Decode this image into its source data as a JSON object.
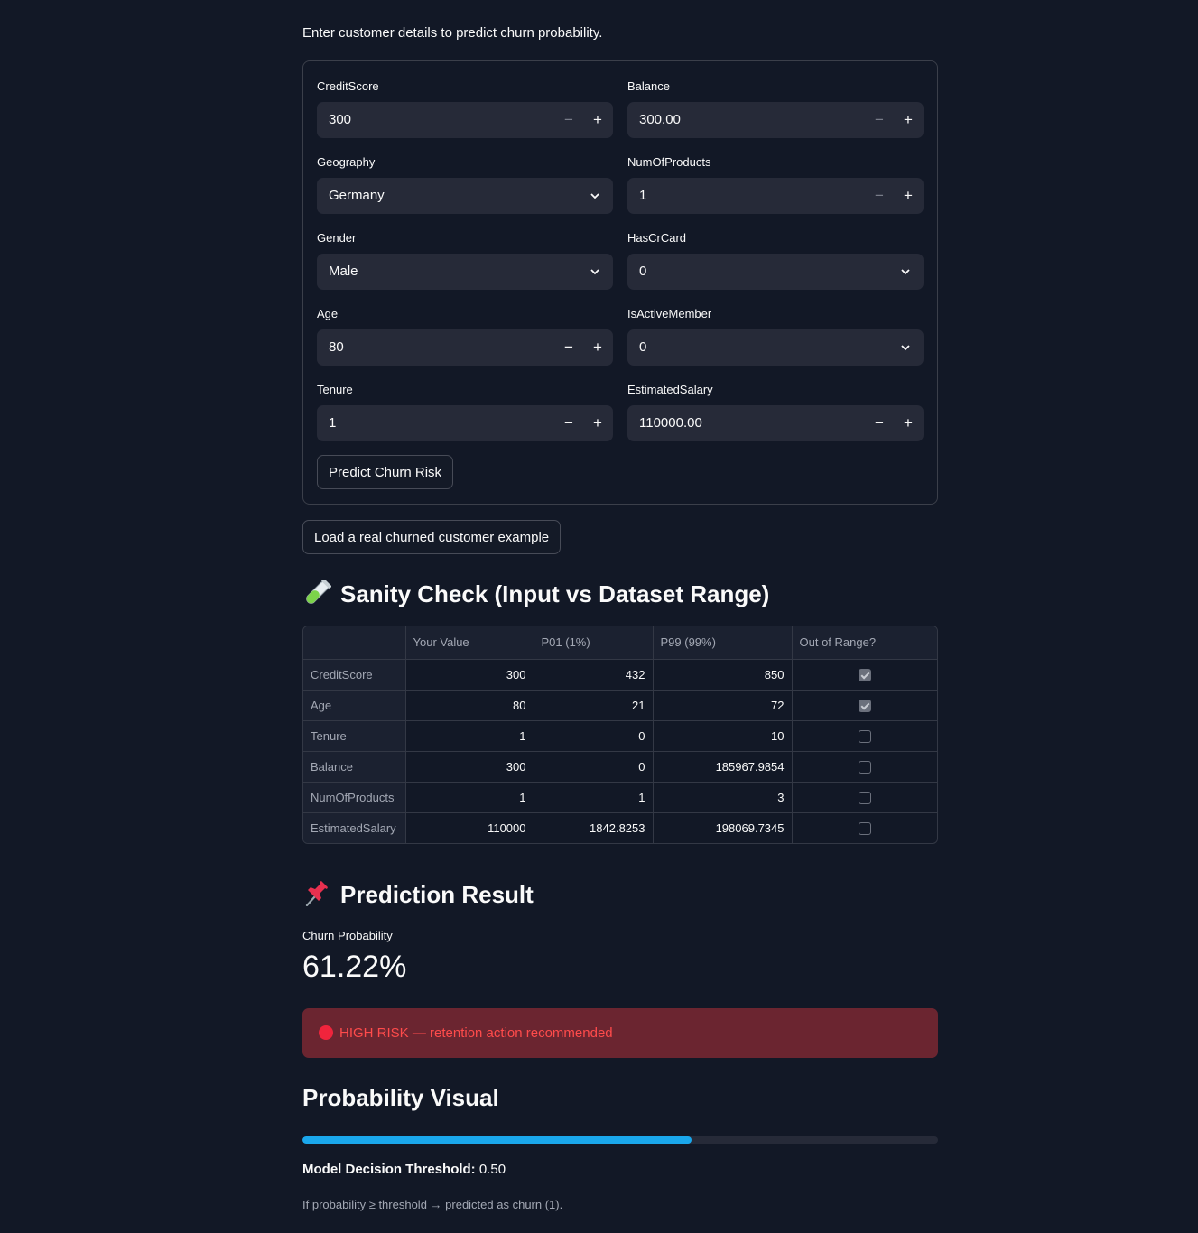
{
  "intro": "Enter customer details to predict churn probability.",
  "form": {
    "credit_score": {
      "label": "CreditScore",
      "value": "300"
    },
    "balance": {
      "label": "Balance",
      "value": "300.00"
    },
    "geography": {
      "label": "Geography",
      "value": "Germany"
    },
    "num_products": {
      "label": "NumOfProducts",
      "value": "1"
    },
    "gender": {
      "label": "Gender",
      "value": "Male"
    },
    "has_cr_card": {
      "label": "HasCrCard",
      "value": "0"
    },
    "age": {
      "label": "Age",
      "value": "80"
    },
    "is_active": {
      "label": "IsActiveMember",
      "value": "0"
    },
    "tenure": {
      "label": "Tenure",
      "value": "1"
    },
    "salary": {
      "label": "EstimatedSalary",
      "value": "110000.00"
    },
    "minus": "−",
    "plus": "+",
    "predict_label": "Predict Churn Risk"
  },
  "load_example_label": "Load a real churned customer example",
  "sanity": {
    "title": "Sanity Check (Input vs Dataset Range)",
    "icon": "test-tube-icon",
    "columns": [
      "",
      "Your Value",
      "P01 (1%)",
      "P99 (99%)",
      "Out of Range?"
    ],
    "rows": [
      {
        "feature": "CreditScore",
        "value": "300",
        "p01": "432",
        "p99": "850",
        "out": true
      },
      {
        "feature": "Age",
        "value": "80",
        "p01": "21",
        "p99": "72",
        "out": true
      },
      {
        "feature": "Tenure",
        "value": "1",
        "p01": "0",
        "p99": "10",
        "out": false
      },
      {
        "feature": "Balance",
        "value": "300",
        "p01": "0",
        "p99": "185967.9854",
        "out": false
      },
      {
        "feature": "NumOfProducts",
        "value": "1",
        "p01": "1",
        "p99": "3",
        "out": false
      },
      {
        "feature": "EstimatedSalary",
        "value": "110000",
        "p01": "1842.8253",
        "p99": "198069.7345",
        "out": false
      }
    ]
  },
  "prediction": {
    "title": "Prediction Result",
    "icon": "pushpin-icon",
    "metric_label": "Churn Probability",
    "metric_value": "61.22%",
    "alert_text": "HIGH RISK — retention action recommended",
    "alert_color": "#ff4b4b"
  },
  "visual": {
    "title": "Probability Visual",
    "progress_fraction": 0.6122,
    "threshold_label": "Model Decision Threshold:",
    "threshold_value": " 0.50",
    "note": "If probability ≥ threshold → predicted as churn (1)."
  },
  "colors": {
    "background": "#121826",
    "accent": "#1aa7ec",
    "alert_bg": "#6b2530"
  }
}
